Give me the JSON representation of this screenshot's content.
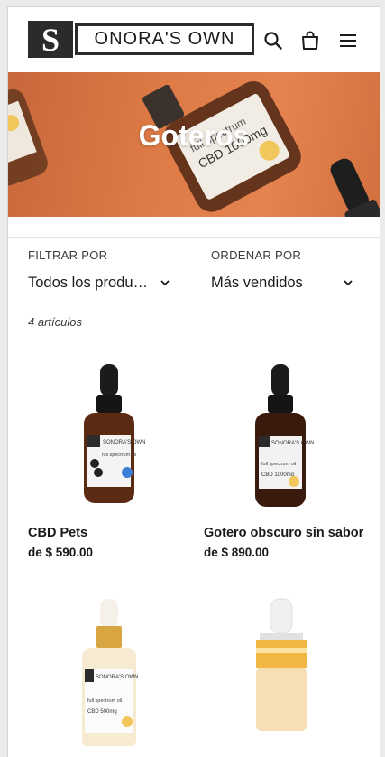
{
  "header": {
    "logo_letter": "S",
    "logo_text": "ONORA'S OWN"
  },
  "banner": {
    "title": "Goteros"
  },
  "filters": {
    "filter_label": "FILTRAR POR",
    "filter_value": "Todos los produ…",
    "sort_label": "ORDENAR POR",
    "sort_value": "Más vendidos"
  },
  "collection": {
    "count_text": "4 artículos"
  },
  "products": [
    {
      "name": "CBD Pets",
      "price": "de $ 590.00"
    },
    {
      "name": "Gotero obscuro sin sabor",
      "price": "de $ 890.00"
    },
    {
      "name": "",
      "price": ""
    },
    {
      "name": "",
      "price": ""
    }
  ],
  "product_image_labels": {
    "brand": "SONORA'S OWN",
    "oil": "full spectrum oil",
    "cbd_1000": "CBD 1000mg",
    "cbd_500": "CBD 500mg"
  },
  "colors": {
    "banner_orange": "#dd7a45",
    "text": "#1a1a1a",
    "border": "#e3e3e3"
  }
}
